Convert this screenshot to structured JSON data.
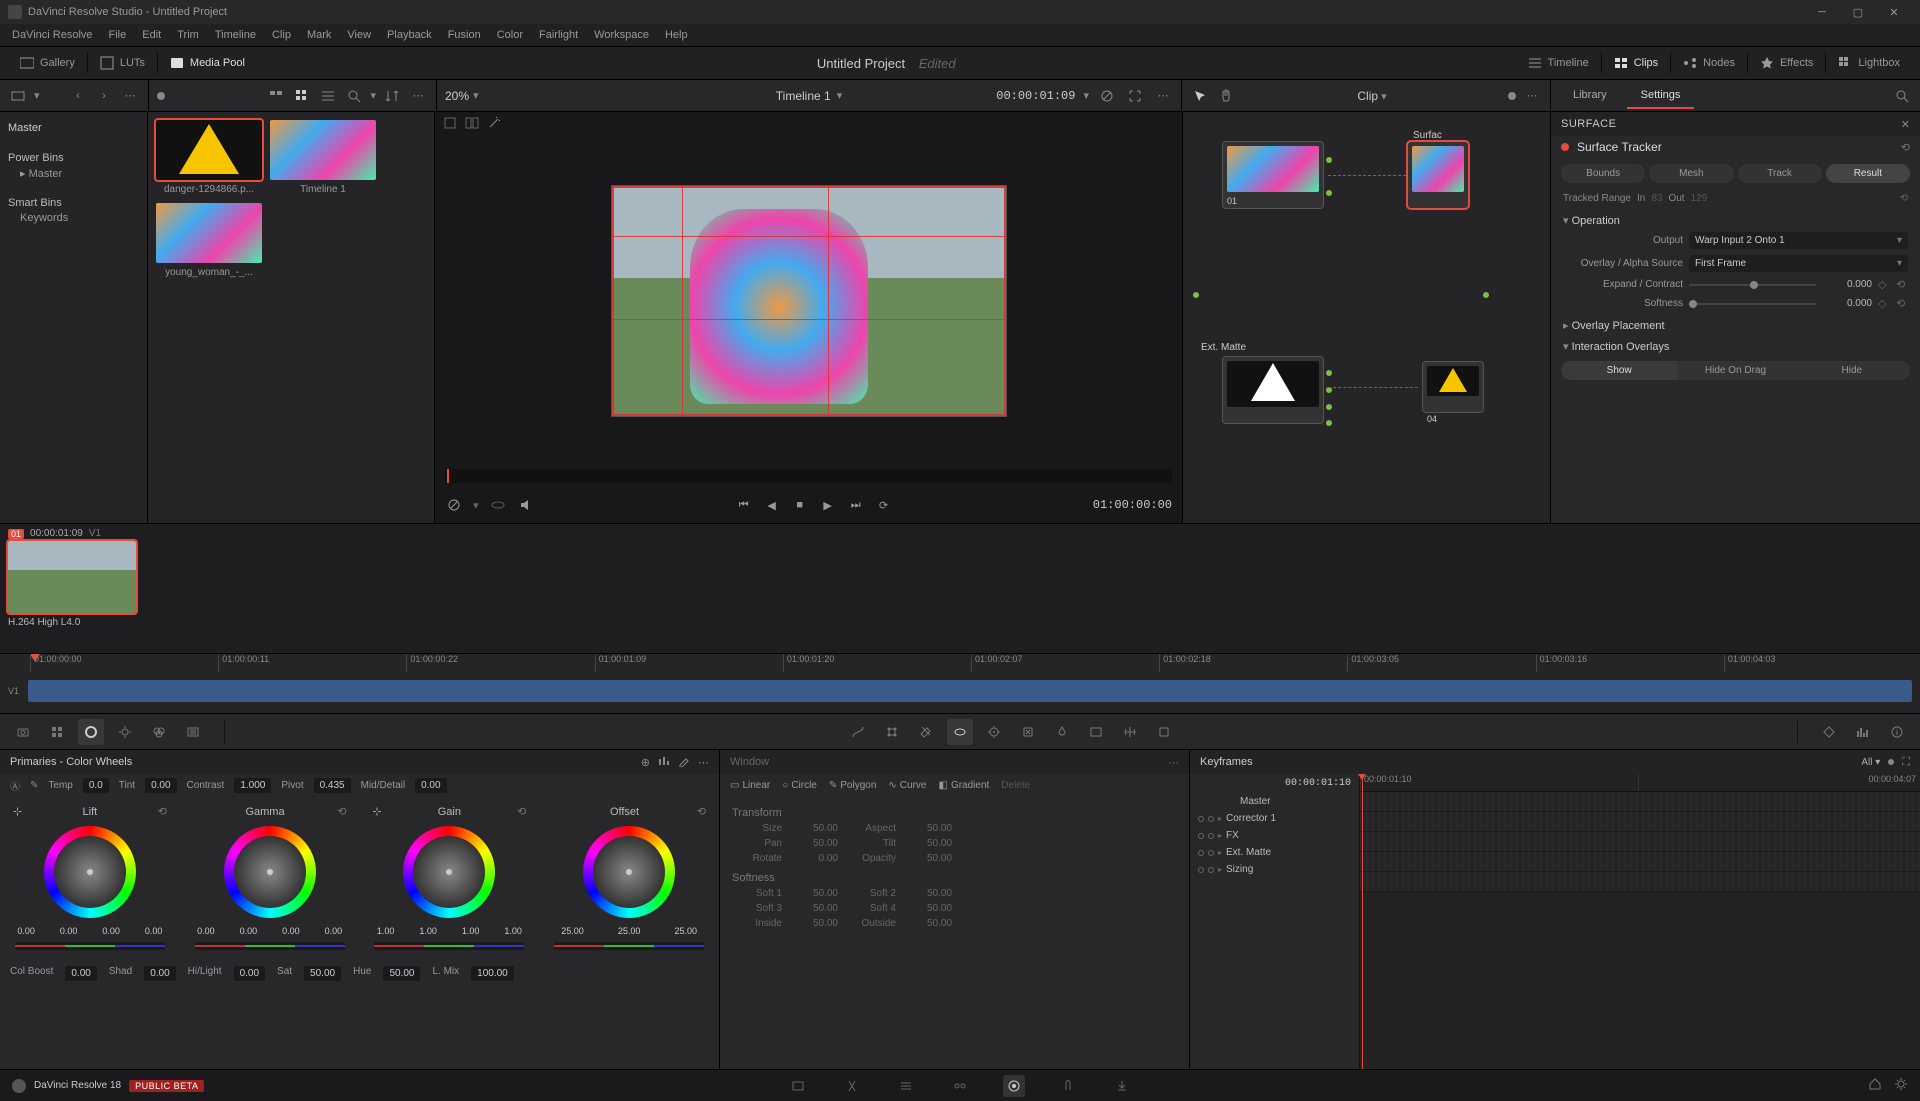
{
  "window": {
    "title": "DaVinci Resolve Studio - Untitled Project"
  },
  "menu": [
    "DaVinci Resolve",
    "File",
    "Edit",
    "Trim",
    "Timeline",
    "Clip",
    "Mark",
    "View",
    "Playback",
    "Fusion",
    "Color",
    "Fairlight",
    "Workspace",
    "Help"
  ],
  "top_toolbar": {
    "gallery": "Gallery",
    "luts": "LUTs",
    "media_pool": "Media Pool",
    "project_title": "Untitled Project",
    "edited": "Edited",
    "timeline": "Timeline",
    "clips": "Clips",
    "nodes": "Nodes",
    "effects": "Effects",
    "lightbox": "Lightbox"
  },
  "sec_bar": {
    "zoom": "20%",
    "timeline_name": "Timeline 1",
    "timecode": "00:00:01:09",
    "clip_dd": "Clip",
    "library": "Library",
    "settings": "Settings"
  },
  "bins": {
    "master": "Master",
    "power_bins": "Power Bins",
    "pb_master": "Master",
    "smart_bins": "Smart Bins",
    "keywords": "Keywords"
  },
  "media_pool": {
    "items": [
      {
        "name": "danger-1294866.p..."
      },
      {
        "name": "Timeline 1"
      },
      {
        "name": "young_woman_-_..."
      }
    ]
  },
  "viewer": {
    "tc_end": "01:00:00:00"
  },
  "nodes_panel": {
    "ext_matte": "Ext. Matte",
    "surface": "Surfac",
    "n01": "01",
    "n04": "04"
  },
  "inspector": {
    "header": "SURFACE",
    "tracker_label": "Surface Tracker",
    "tabs": {
      "bounds": "Bounds",
      "mesh": "Mesh",
      "track": "Track",
      "result": "Result"
    },
    "tracked_range": "Tracked Range",
    "in_lbl": "In",
    "in_v": "83",
    "out_lbl": "Out",
    "out_v": "129",
    "operation": "Operation",
    "output_lbl": "Output",
    "output_val": "Warp Input 2 Onto 1",
    "overlay_src_lbl": "Overlay / Alpha Source",
    "overlay_src_val": "First Frame",
    "expand_lbl": "Expand / Contract",
    "expand_val": "0.000",
    "softness_lbl": "Softness",
    "softness_val": "0.000",
    "overlay_placement": "Overlay Placement",
    "interaction": "Interaction Overlays",
    "seg": {
      "show": "Show",
      "hide_drag": "Hide On Drag",
      "hide": "Hide"
    }
  },
  "clip_strip": {
    "num": "01",
    "tc": "00:00:01:09",
    "track": "V1",
    "codec": "H.264 High L4.0"
  },
  "timeline_ticks": [
    "01:00:00:00",
    "01:00:00:11",
    "01:00:00:22",
    "01:00:01:09",
    "01:00:01:20",
    "01:00:02:07",
    "01:00:02:18",
    "01:00:03:05",
    "01:00:03:16",
    "01:00:04:03"
  ],
  "timeline_track": "V1",
  "primaries": {
    "title": "Primaries - Color Wheels",
    "adj": {
      "temp": "Temp",
      "temp_v": "0.0",
      "tint": "Tint",
      "tint_v": "0.00",
      "contrast": "Contrast",
      "contrast_v": "1.000",
      "pivot": "Pivot",
      "pivot_v": "0.435",
      "md": "Mid/Detail",
      "md_v": "0.00"
    },
    "wheels": {
      "lift": {
        "name": "Lift",
        "vals": [
          "0.00",
          "0.00",
          "0.00",
          "0.00"
        ]
      },
      "gamma": {
        "name": "Gamma",
        "vals": [
          "0.00",
          "0.00",
          "0.00",
          "0.00"
        ]
      },
      "gain": {
        "name": "Gain",
        "vals": [
          "1.00",
          "1.00",
          "1.00",
          "1.00"
        ]
      },
      "offset": {
        "name": "Offset",
        "vals": [
          "25.00",
          "25.00",
          "25.00"
        ]
      }
    },
    "bot": {
      "colboost": "Col Boost",
      "colboost_v": "0.00",
      "shad": "Shad",
      "shad_v": "0.00",
      "hl": "Hi/Light",
      "hl_v": "0.00",
      "sat": "Sat",
      "sat_v": "50.00",
      "hue": "Hue",
      "hue_v": "50.00",
      "lmix": "L. Mix",
      "lmix_v": "100.00"
    }
  },
  "windows": {
    "title": "Window",
    "tools": {
      "linear": "Linear",
      "circle": "Circle",
      "polygon": "Polygon",
      "curve": "Curve",
      "gradient": "Gradient",
      "delete": "Delete"
    },
    "transform": "Transform",
    "tfm": {
      "size": "Size",
      "size_v": "50.00",
      "aspect": "Aspect",
      "aspect_v": "50.00",
      "pan": "Pan",
      "pan_v": "50.00",
      "tilt": "Tilt",
      "tilt_v": "50.00",
      "rotate": "Rotate",
      "rotate_v": "0.00",
      "opacity": "Opacity",
      "opacity_v": "50.00"
    },
    "softness": "Softness",
    "soft": {
      "s1": "Soft 1",
      "s1_v": "50.00",
      "s2": "Soft 2",
      "s2_v": "50.00",
      "s3": "Soft 3",
      "s3_v": "50.00",
      "s4": "Soft 4",
      "s4_v": "50.00",
      "inside": "Inside",
      "inside_v": "50.00",
      "outside": "Outside",
      "outside_v": "50.00"
    }
  },
  "keyframes": {
    "title": "Keyframes",
    "mode": "All",
    "tc": "00:00:01:10",
    "ruler": [
      "00:00:01:10",
      "00:00:04:07"
    ],
    "nodes": [
      "Master",
      "Corrector 1",
      "FX",
      "Ext. Matte",
      "Sizing"
    ]
  },
  "page_nav": {
    "app": "DaVinci Resolve 18",
    "beta": "PUBLIC BETA"
  }
}
